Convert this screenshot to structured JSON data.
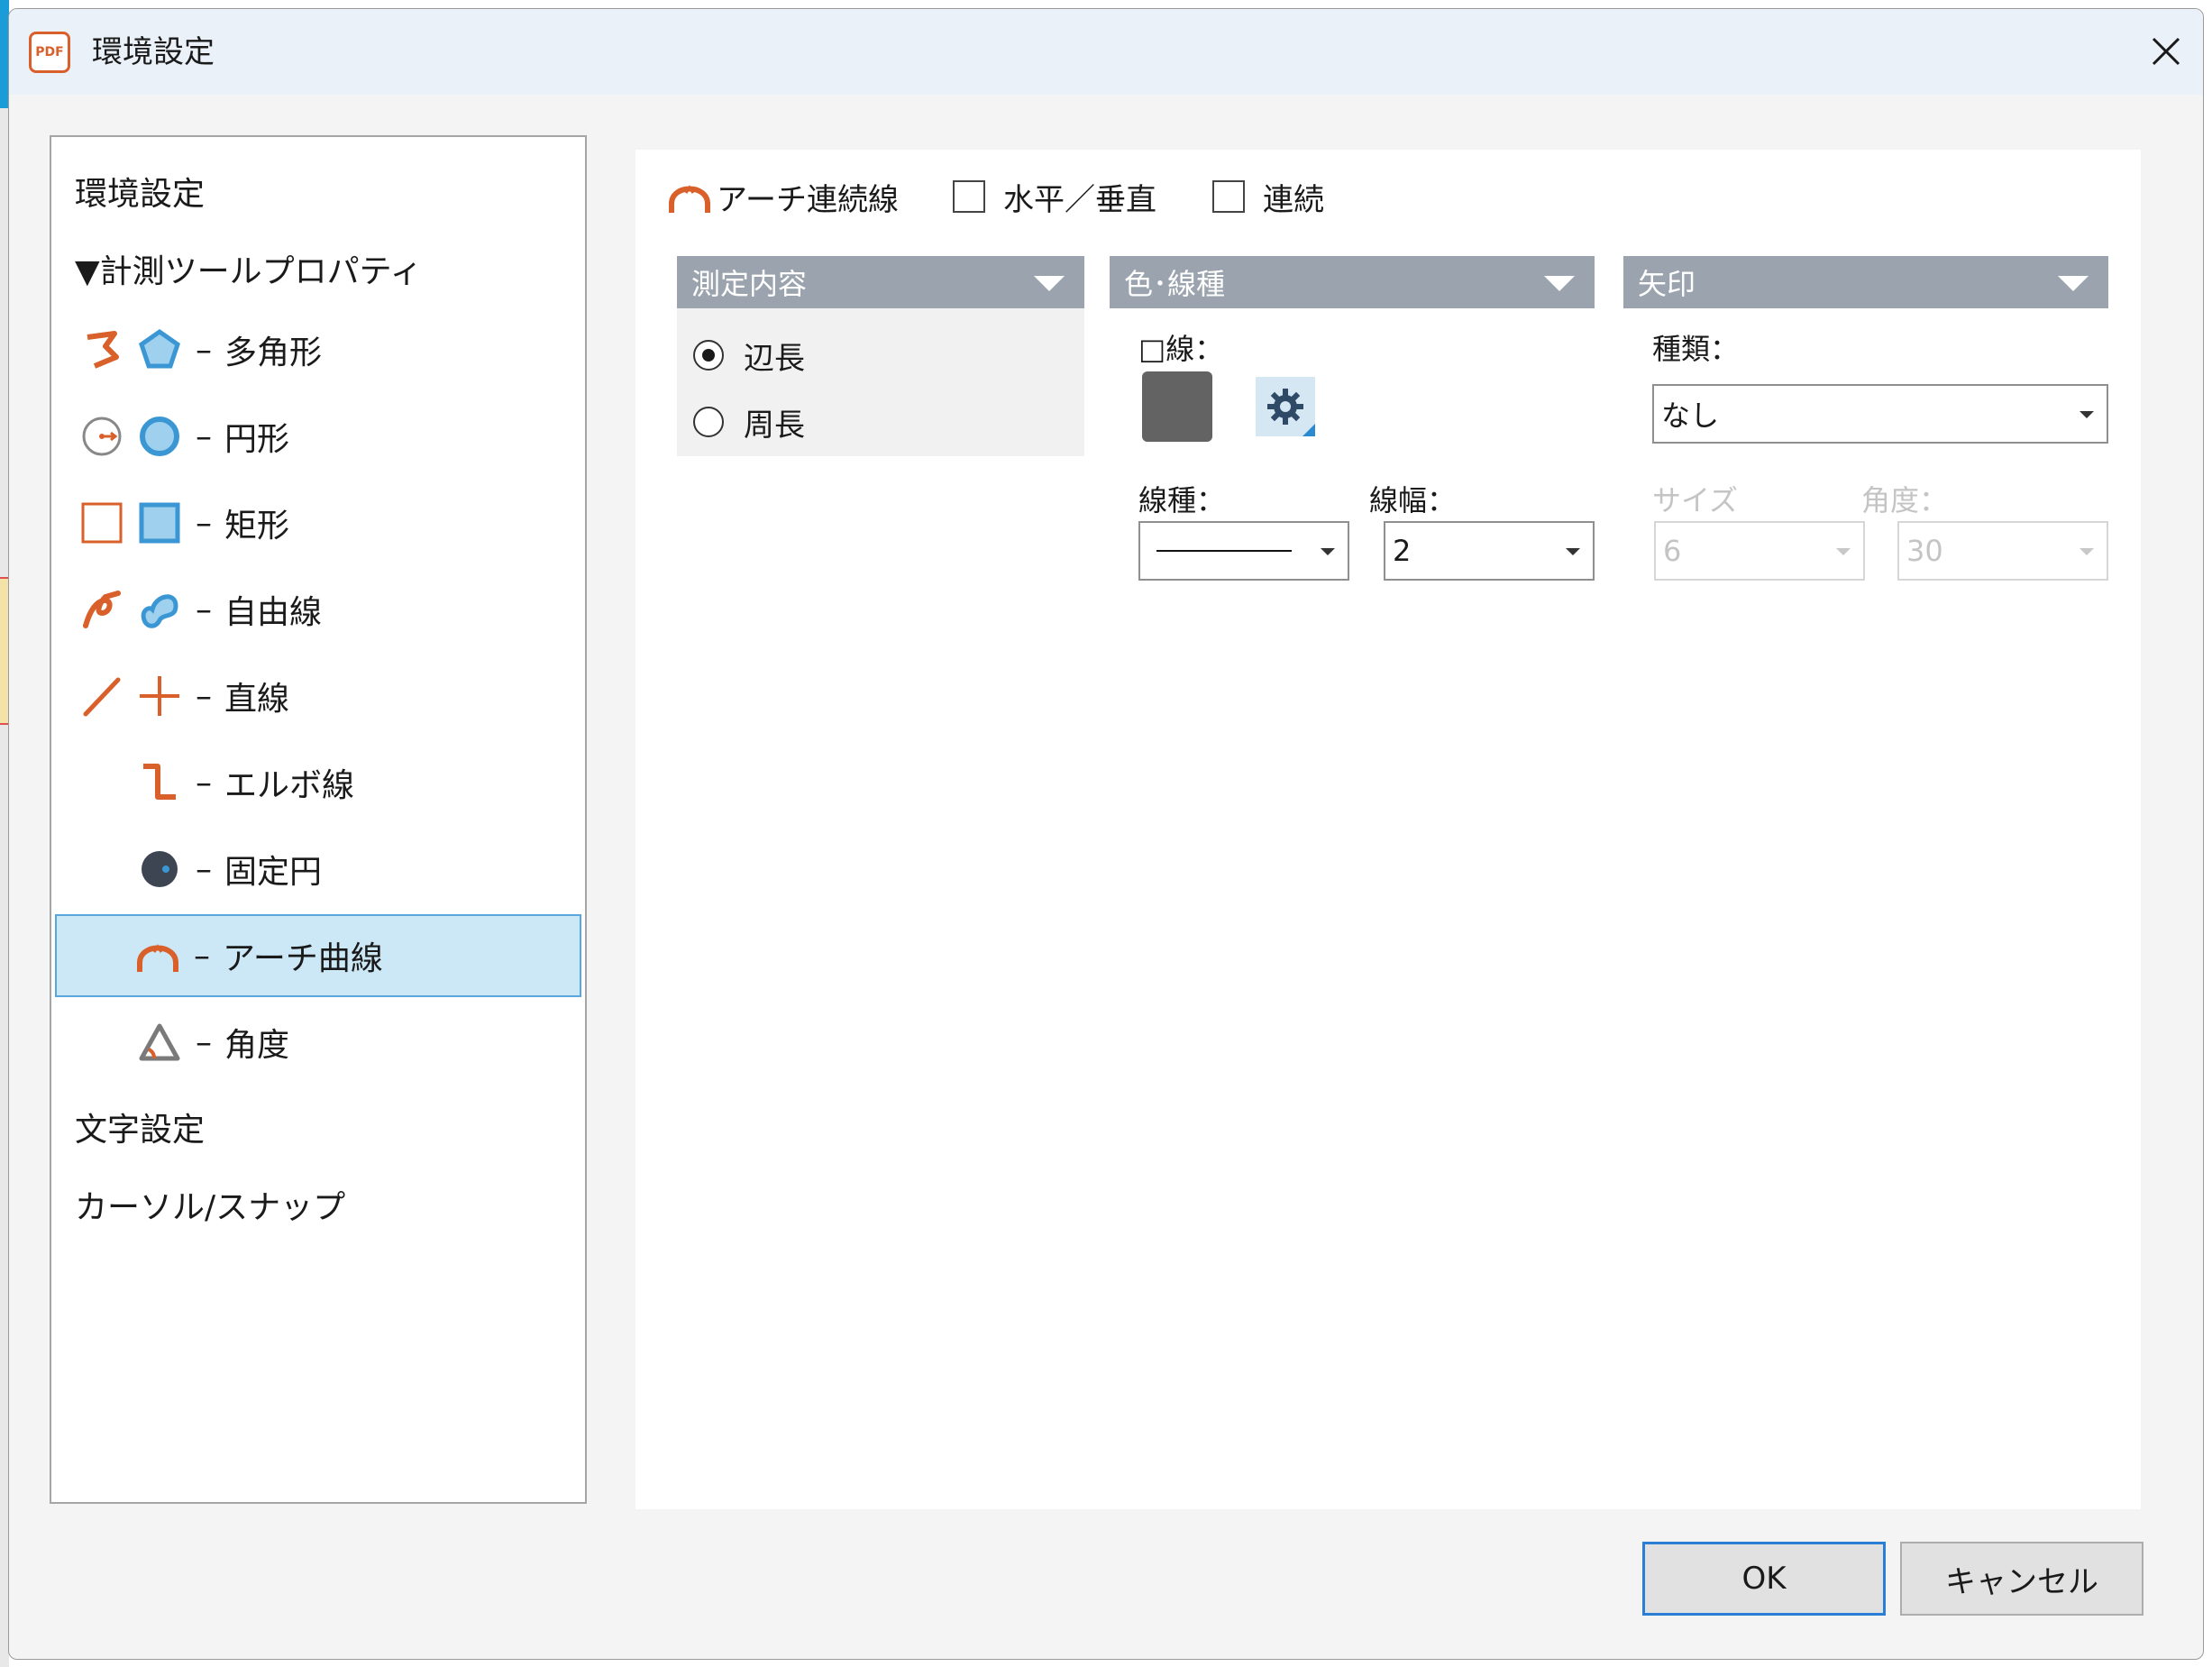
{
  "window": {
    "app_icon_text": "PDF",
    "title": "環境設定"
  },
  "tree": {
    "items": [
      {
        "label": "環境設定"
      },
      {
        "label": "▼計測ツールプロパティ"
      },
      {
        "label": "多角形",
        "prefix": "–"
      },
      {
        "label": "円形",
        "prefix": "–"
      },
      {
        "label": "矩形",
        "prefix": "–"
      },
      {
        "label": "自由線",
        "prefix": "–"
      },
      {
        "label": "直線",
        "prefix": "–"
      },
      {
        "label": "エルボ線",
        "prefix": "–"
      },
      {
        "label": "固定円",
        "prefix": "–"
      },
      {
        "label": "アーチ曲線",
        "prefix": "–"
      },
      {
        "label": "角度",
        "prefix": "–"
      },
      {
        "label": "文字設定"
      },
      {
        "label": "カーソル/スナップ"
      }
    ],
    "selected_index": 9
  },
  "panel": {
    "tool_label": "アーチ連続線",
    "check_horizontal_vertical": "水平／垂直",
    "check_continuous": "連続",
    "sections": {
      "measure": {
        "title": "測定内容",
        "option_edge": "辺長",
        "option_perimeter": "周長",
        "selected": "辺長"
      },
      "color_line": {
        "title": "色･線種",
        "line_color_label": "□線：",
        "line_color": "#636363",
        "line_type_label": "線種：",
        "line_width_label": "線幅：",
        "line_width_value": "2"
      },
      "arrow": {
        "title": "矢印",
        "kind_label": "種類：",
        "kind_value": "なし",
        "size_label": "サイズ",
        "size_value": "6",
        "angle_label": "角度：",
        "angle_value": "30"
      }
    }
  },
  "buttons": {
    "ok": "OK",
    "cancel": "キャンセル"
  },
  "colors": {
    "accent_orange": "#d9602a",
    "accent_blue": "#3a97d4",
    "selection_bg": "#cce8f6",
    "selection_border": "#5aa7dd",
    "section_header": "#9ba4ae"
  }
}
